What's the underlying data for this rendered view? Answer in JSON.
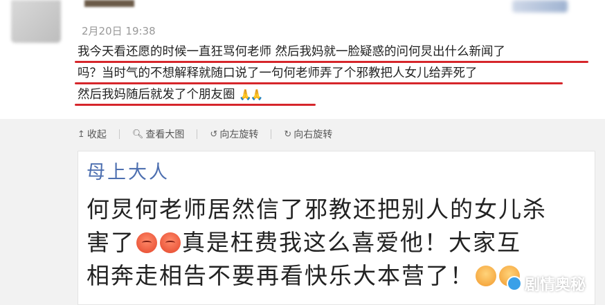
{
  "post": {
    "date": "2月20日 19:38",
    "lines": [
      "我今天看还愿的时候一直狂骂何老师 然后我妈就一脸疑惑的问何炅出什么新闻了",
      "吗？当时气的不想解释就随口说了一句何老师弄了个邪教把人女儿给弄死了",
      "然后我妈随后就发了个朋友圈"
    ],
    "underline_color": "#d6262b"
  },
  "actions": {
    "collapse": "收起",
    "view_large": "查看大图",
    "rotate_left": "向左旋转",
    "rotate_right": "向右旋转"
  },
  "card": {
    "name": "母上大人",
    "name_color": "#4d6fb0",
    "line1": "何炅何老师居然信了邪教还把别人的女儿杀",
    "line2_pre": "害了",
    "line2_post": "真是枉费我这么喜爱他！大家互",
    "line3": "相奔走相告不要再看快乐大本营了！"
  },
  "watermark": {
    "text": "剧情奥秘"
  }
}
